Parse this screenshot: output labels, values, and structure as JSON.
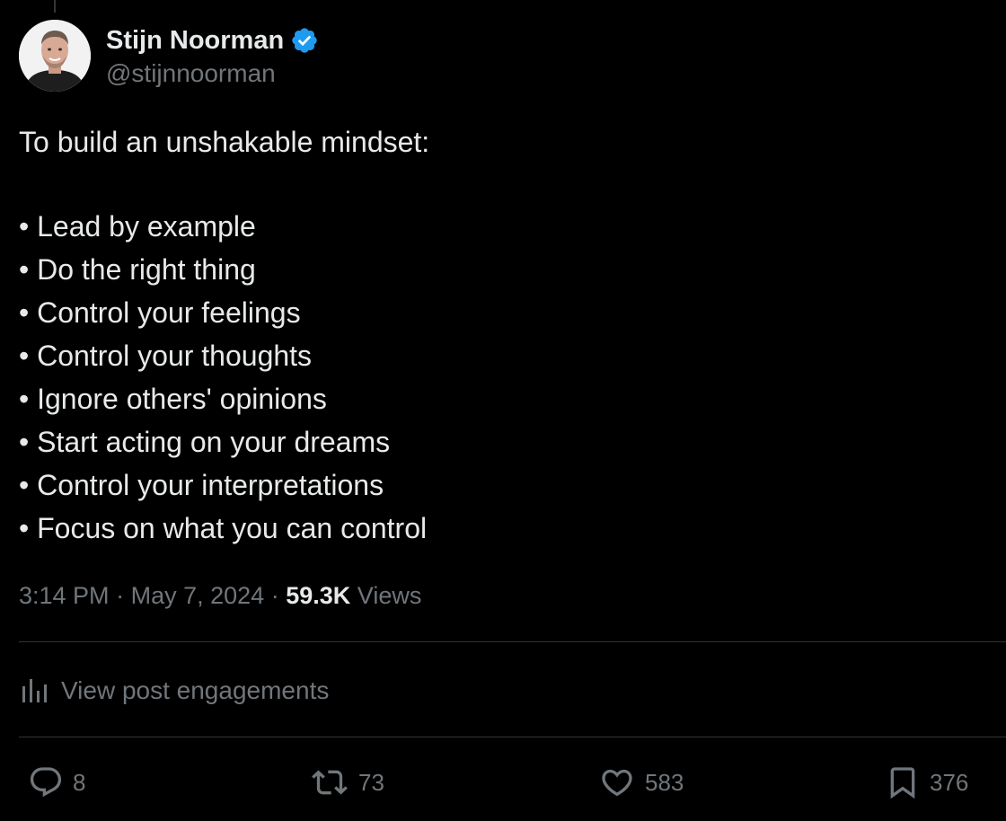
{
  "author": {
    "display_name": "Stijn Noorman",
    "handle": "@stijnnoorman",
    "verified": true,
    "avatar_icon": "avatar-photo",
    "verified_icon": "verified-badge-icon"
  },
  "post": {
    "intro": "To build an unshakable mindset:",
    "bullets": [
      "• Lead by example",
      "• Do the right thing",
      "• Control your feelings",
      "• Control your thoughts",
      "• Ignore others' opinions",
      "• Start acting on your dreams",
      "• Control your interpretations",
      "• Focus on what you can control"
    ]
  },
  "meta": {
    "time": "3:14 PM",
    "separator": "·",
    "date": "May 7, 2024",
    "views_count": "59.3K",
    "views_label": "Views"
  },
  "engagements": {
    "label": "View post engagements",
    "icon": "analytics-bars-icon"
  },
  "actions": {
    "reply": {
      "icon": "reply-icon",
      "count": "8"
    },
    "repost": {
      "icon": "repost-icon",
      "count": "73"
    },
    "like": {
      "icon": "heart-icon",
      "count": "583"
    },
    "bookmark": {
      "icon": "bookmark-icon",
      "count": "376"
    }
  },
  "colors": {
    "background": "#000000",
    "primary_text": "#e7e9ea",
    "secondary_text": "#71767b",
    "divider": "#2f3336",
    "verified_blue": "#1d9bf0"
  }
}
